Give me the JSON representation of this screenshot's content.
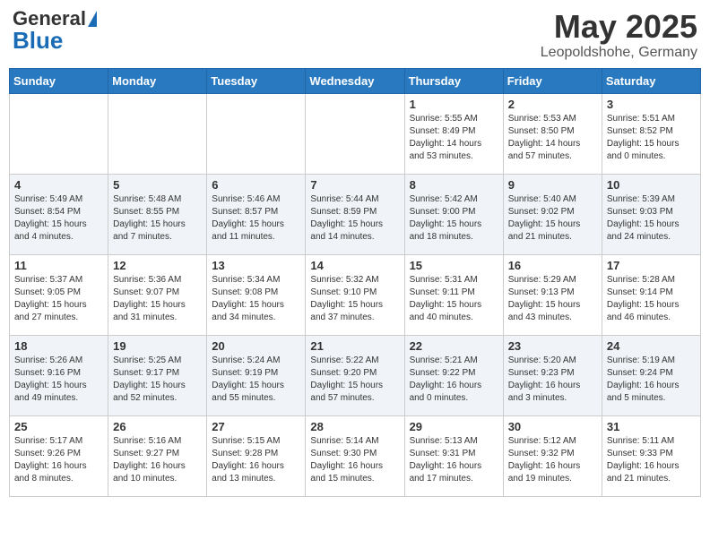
{
  "header": {
    "logo_general": "General",
    "logo_blue": "Blue",
    "month_year": "May 2025",
    "location": "Leopoldshohe, Germany"
  },
  "weekdays": [
    "Sunday",
    "Monday",
    "Tuesday",
    "Wednesday",
    "Thursday",
    "Friday",
    "Saturday"
  ],
  "weeks": [
    [
      {
        "day": "",
        "info": ""
      },
      {
        "day": "",
        "info": ""
      },
      {
        "day": "",
        "info": ""
      },
      {
        "day": "",
        "info": ""
      },
      {
        "day": "1",
        "info": "Sunrise: 5:55 AM\nSunset: 8:49 PM\nDaylight: 14 hours\nand 53 minutes."
      },
      {
        "day": "2",
        "info": "Sunrise: 5:53 AM\nSunset: 8:50 PM\nDaylight: 14 hours\nand 57 minutes."
      },
      {
        "day": "3",
        "info": "Sunrise: 5:51 AM\nSunset: 8:52 PM\nDaylight: 15 hours\nand 0 minutes."
      }
    ],
    [
      {
        "day": "4",
        "info": "Sunrise: 5:49 AM\nSunset: 8:54 PM\nDaylight: 15 hours\nand 4 minutes."
      },
      {
        "day": "5",
        "info": "Sunrise: 5:48 AM\nSunset: 8:55 PM\nDaylight: 15 hours\nand 7 minutes."
      },
      {
        "day": "6",
        "info": "Sunrise: 5:46 AM\nSunset: 8:57 PM\nDaylight: 15 hours\nand 11 minutes."
      },
      {
        "day": "7",
        "info": "Sunrise: 5:44 AM\nSunset: 8:59 PM\nDaylight: 15 hours\nand 14 minutes."
      },
      {
        "day": "8",
        "info": "Sunrise: 5:42 AM\nSunset: 9:00 PM\nDaylight: 15 hours\nand 18 minutes."
      },
      {
        "day": "9",
        "info": "Sunrise: 5:40 AM\nSunset: 9:02 PM\nDaylight: 15 hours\nand 21 minutes."
      },
      {
        "day": "10",
        "info": "Sunrise: 5:39 AM\nSunset: 9:03 PM\nDaylight: 15 hours\nand 24 minutes."
      }
    ],
    [
      {
        "day": "11",
        "info": "Sunrise: 5:37 AM\nSunset: 9:05 PM\nDaylight: 15 hours\nand 27 minutes."
      },
      {
        "day": "12",
        "info": "Sunrise: 5:36 AM\nSunset: 9:07 PM\nDaylight: 15 hours\nand 31 minutes."
      },
      {
        "day": "13",
        "info": "Sunrise: 5:34 AM\nSunset: 9:08 PM\nDaylight: 15 hours\nand 34 minutes."
      },
      {
        "day": "14",
        "info": "Sunrise: 5:32 AM\nSunset: 9:10 PM\nDaylight: 15 hours\nand 37 minutes."
      },
      {
        "day": "15",
        "info": "Sunrise: 5:31 AM\nSunset: 9:11 PM\nDaylight: 15 hours\nand 40 minutes."
      },
      {
        "day": "16",
        "info": "Sunrise: 5:29 AM\nSunset: 9:13 PM\nDaylight: 15 hours\nand 43 minutes."
      },
      {
        "day": "17",
        "info": "Sunrise: 5:28 AM\nSunset: 9:14 PM\nDaylight: 15 hours\nand 46 minutes."
      }
    ],
    [
      {
        "day": "18",
        "info": "Sunrise: 5:26 AM\nSunset: 9:16 PM\nDaylight: 15 hours\nand 49 minutes."
      },
      {
        "day": "19",
        "info": "Sunrise: 5:25 AM\nSunset: 9:17 PM\nDaylight: 15 hours\nand 52 minutes."
      },
      {
        "day": "20",
        "info": "Sunrise: 5:24 AM\nSunset: 9:19 PM\nDaylight: 15 hours\nand 55 minutes."
      },
      {
        "day": "21",
        "info": "Sunrise: 5:22 AM\nSunset: 9:20 PM\nDaylight: 15 hours\nand 57 minutes."
      },
      {
        "day": "22",
        "info": "Sunrise: 5:21 AM\nSunset: 9:22 PM\nDaylight: 16 hours\nand 0 minutes."
      },
      {
        "day": "23",
        "info": "Sunrise: 5:20 AM\nSunset: 9:23 PM\nDaylight: 16 hours\nand 3 minutes."
      },
      {
        "day": "24",
        "info": "Sunrise: 5:19 AM\nSunset: 9:24 PM\nDaylight: 16 hours\nand 5 minutes."
      }
    ],
    [
      {
        "day": "25",
        "info": "Sunrise: 5:17 AM\nSunset: 9:26 PM\nDaylight: 16 hours\nand 8 minutes."
      },
      {
        "day": "26",
        "info": "Sunrise: 5:16 AM\nSunset: 9:27 PM\nDaylight: 16 hours\nand 10 minutes."
      },
      {
        "day": "27",
        "info": "Sunrise: 5:15 AM\nSunset: 9:28 PM\nDaylight: 16 hours\nand 13 minutes."
      },
      {
        "day": "28",
        "info": "Sunrise: 5:14 AM\nSunset: 9:30 PM\nDaylight: 16 hours\nand 15 minutes."
      },
      {
        "day": "29",
        "info": "Sunrise: 5:13 AM\nSunset: 9:31 PM\nDaylight: 16 hours\nand 17 minutes."
      },
      {
        "day": "30",
        "info": "Sunrise: 5:12 AM\nSunset: 9:32 PM\nDaylight: 16 hours\nand 19 minutes."
      },
      {
        "day": "31",
        "info": "Sunrise: 5:11 AM\nSunset: 9:33 PM\nDaylight: 16 hours\nand 21 minutes."
      }
    ]
  ]
}
